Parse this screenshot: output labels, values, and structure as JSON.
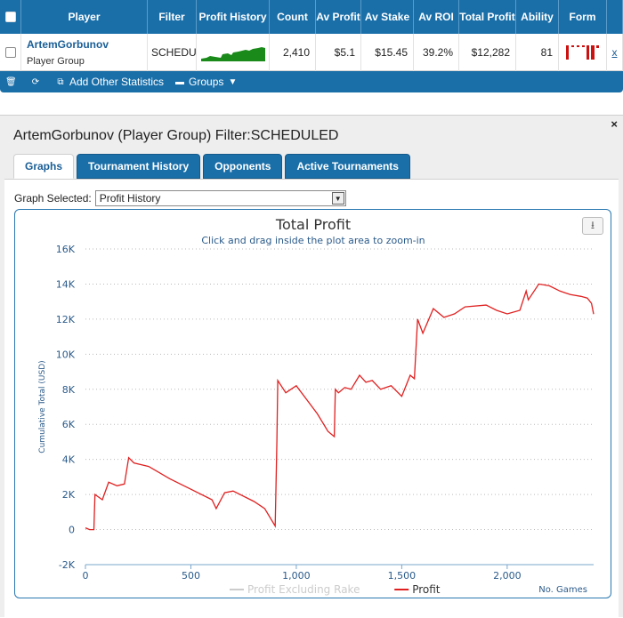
{
  "table": {
    "headers": [
      "Player",
      "Filter",
      "Profit History",
      "Count",
      "Av Profit",
      "Av Stake",
      "Av ROI",
      "Total Profit",
      "Ability",
      "Form"
    ],
    "row": {
      "player_name": "ArtemGorbunov",
      "player_sub": "Player Group",
      "filter": "SCHEDULED",
      "count": "2,410",
      "av_profit": "$5.1",
      "av_stake": "$15.45",
      "av_roi": "39.2%",
      "total_profit": "$12,282",
      "ability": "81",
      "remove": "x"
    }
  },
  "toolbar": {
    "add_stats": "Add Other Statistics",
    "groups": "Groups"
  },
  "panel": {
    "title": "ArtemGorbunov (Player Group) Filter:SCHEDULED",
    "close": "×",
    "tabs": [
      "Graphs",
      "Tournament History",
      "Opponents",
      "Active Tournaments"
    ],
    "graph_selected_label": "Graph Selected:",
    "graph_selected_value": "Profit History"
  },
  "colors": {
    "header_blue": "#1a6fa9",
    "profit_line": "#e02020",
    "sparkline": "#1a8a1a",
    "form_bars": "#cc1111"
  },
  "chart_data": {
    "type": "line",
    "title": "Total Profit",
    "subtitle": "Click and drag inside the plot area to zoom-in",
    "ylabel": "Cumulative Total (USD)",
    "xlabel": "No. Games",
    "ylim": [
      -2000,
      16000
    ],
    "xlim": [
      0,
      2410
    ],
    "y_ticks": [
      -2000,
      0,
      2000,
      4000,
      6000,
      8000,
      10000,
      12000,
      14000,
      16000
    ],
    "y_tick_labels": [
      "-2K",
      "0",
      "2K",
      "4K",
      "6K",
      "8K",
      "10K",
      "12K",
      "14K",
      "16K"
    ],
    "x_ticks": [
      0,
      500,
      1000,
      1500,
      2000
    ],
    "x_tick_labels": [
      "0",
      "500",
      "1,000",
      "1,500",
      "2,000"
    ],
    "grid": true,
    "legend": "bottom-center",
    "series": [
      {
        "name": "Profit Excluding Rake",
        "color": "#cccccc",
        "x": [],
        "y": []
      },
      {
        "name": "Profit",
        "color": "#e02020",
        "x": [
          0,
          20,
          40,
          45,
          80,
          110,
          150,
          185,
          205,
          230,
          300,
          400,
          500,
          600,
          620,
          660,
          700,
          800,
          850,
          900,
          908,
          912,
          950,
          1000,
          1050,
          1100,
          1150,
          1180,
          1185,
          1200,
          1230,
          1260,
          1300,
          1330,
          1360,
          1400,
          1450,
          1500,
          1540,
          1560,
          1575,
          1600,
          1650,
          1700,
          1750,
          1800,
          1900,
          1950,
          2000,
          2060,
          2090,
          2100,
          2150,
          2200,
          2250,
          2300,
          2350,
          2380,
          2400,
          2410
        ],
        "y": [
          100,
          0,
          0,
          2000,
          1700,
          2700,
          2500,
          2600,
          4100,
          3800,
          3600,
          2900,
          2300,
          1700,
          1200,
          2100,
          2200,
          1600,
          1200,
          200,
          5000,
          8500,
          7800,
          8200,
          7400,
          6600,
          5600,
          5300,
          8000,
          7800,
          8100,
          8000,
          8800,
          8400,
          8500,
          8000,
          8200,
          7600,
          8800,
          8600,
          12000,
          11200,
          12600,
          12100,
          12300,
          12700,
          12800,
          12500,
          12300,
          12500,
          13600,
          13100,
          14000,
          13900,
          13600,
          13400,
          13300,
          13200,
          12900,
          12282
        ]
      }
    ]
  }
}
